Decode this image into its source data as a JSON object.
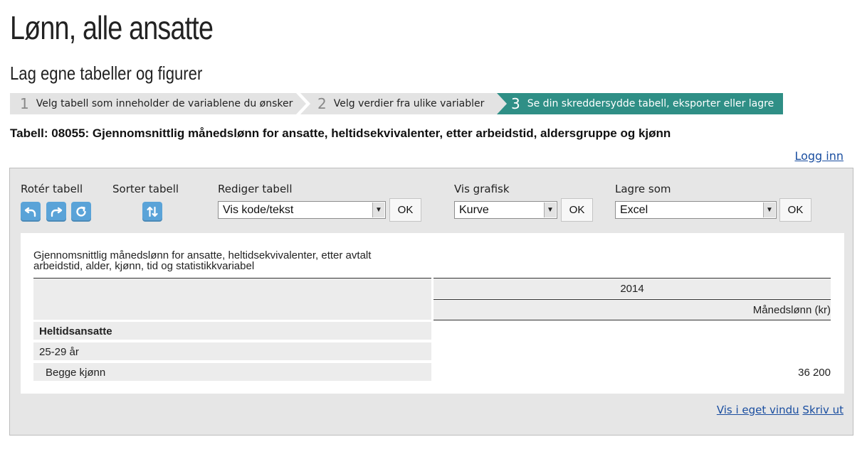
{
  "page": {
    "title": "Lønn, alle ansatte",
    "subtitle": "Lag egne tabeller og figurer"
  },
  "steps": [
    {
      "num": "1",
      "label": "Velg tabell som inneholder de variablene du ønsker"
    },
    {
      "num": "2",
      "label": "Velg verdier fra ulike variabler"
    },
    {
      "num": "3",
      "label": "Se din skreddersydde tabell, eksporter eller lagre"
    }
  ],
  "table_heading": "Tabell: 08055: Gjennomsnittlig månedslønn for ansatte, heltidsekvivalenter, etter arbeidstid, aldersgruppe og kjønn",
  "login_link": "Logg inn",
  "controls": {
    "rotate_label": "Rotér tabell",
    "sort_label": "Sorter tabell",
    "edit_label": "Rediger tabell",
    "edit_value": "Vis kode/tekst",
    "graph_label": "Vis grafisk",
    "graph_value": "Kurve",
    "save_label": "Lagre som",
    "save_value": "Excel",
    "ok_label": "OK"
  },
  "icons": {
    "rotate_left": "rotate-left-icon",
    "rotate_right": "rotate-right-icon",
    "refresh": "refresh-icon",
    "sort": "sort-icon"
  },
  "result_table": {
    "caption": "Gjennomsnittlig månedslønn for ansatte, heltidsekvivalenter, etter avtalt arbeidstid, alder, kjønn, tid og statistikkvariabel",
    "year": "2014",
    "measure": "Månedslønn (kr)",
    "rows": [
      {
        "label": "Heltidsansatte",
        "value": ""
      },
      {
        "label": "25-29 år",
        "value": ""
      },
      {
        "label": "Begge kjønn",
        "value": "36 200"
      }
    ]
  },
  "footer": {
    "view_window": "Vis i eget vindu",
    "print": "Skriv ut"
  },
  "colors": {
    "accent": "#2f8f86",
    "icon_blue": "#5aa3d8",
    "link": "#1a4ea0"
  }
}
